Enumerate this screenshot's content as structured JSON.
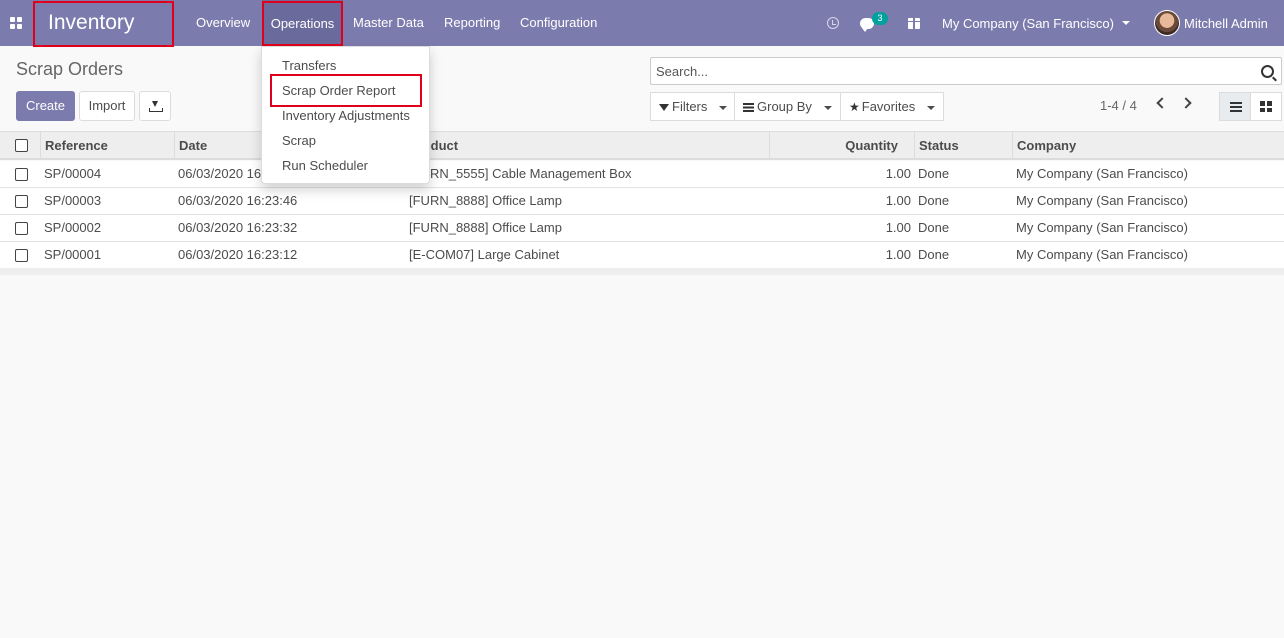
{
  "navbar": {
    "app_name": "Inventory",
    "menu": [
      "Overview",
      "Operations",
      "Master Data",
      "Reporting",
      "Configuration"
    ],
    "messages_count": "3",
    "company": "My Company (San Francisco)",
    "user": "Mitchell Admin"
  },
  "operations_menu": {
    "items": [
      "Transfers",
      "Scrap Order Report",
      "Inventory Adjustments",
      "Scrap",
      "Run Scheduler"
    ]
  },
  "control_panel": {
    "title": "Scrap Orders",
    "create_label": "Create",
    "import_label": "Import",
    "search_placeholder": "Search...",
    "filters_label": "Filters",
    "group_by_label": "Group By",
    "favorites_label": "Favorites",
    "pager": "1-4 / 4"
  },
  "table": {
    "columns": [
      "Reference",
      "Date",
      "Product",
      "Quantity",
      "Status",
      "Company"
    ],
    "rows": [
      {
        "reference": "SP/00004",
        "date": "06/03/2020 16:24:03",
        "product": "[FURN_5555] Cable Management Box",
        "quantity": "1.00",
        "status": "Done",
        "company": "My Company (San Francisco)"
      },
      {
        "reference": "SP/00003",
        "date": "06/03/2020 16:23:46",
        "product": "[FURN_8888] Office Lamp",
        "quantity": "1.00",
        "status": "Done",
        "company": "My Company (San Francisco)"
      },
      {
        "reference": "SP/00002",
        "date": "06/03/2020 16:23:32",
        "product": "[FURN_8888] Office Lamp",
        "quantity": "1.00",
        "status": "Done",
        "company": "My Company (San Francisco)"
      },
      {
        "reference": "SP/00001",
        "date": "06/03/2020 16:23:12",
        "product": "[E-COM07] Large Cabinet",
        "quantity": "1.00",
        "status": "Done",
        "company": "My Company (San Francisco)"
      }
    ]
  },
  "colors": {
    "brand": "#7c7bad",
    "highlight_box": "#e0001b",
    "badge": "#00a09d"
  }
}
